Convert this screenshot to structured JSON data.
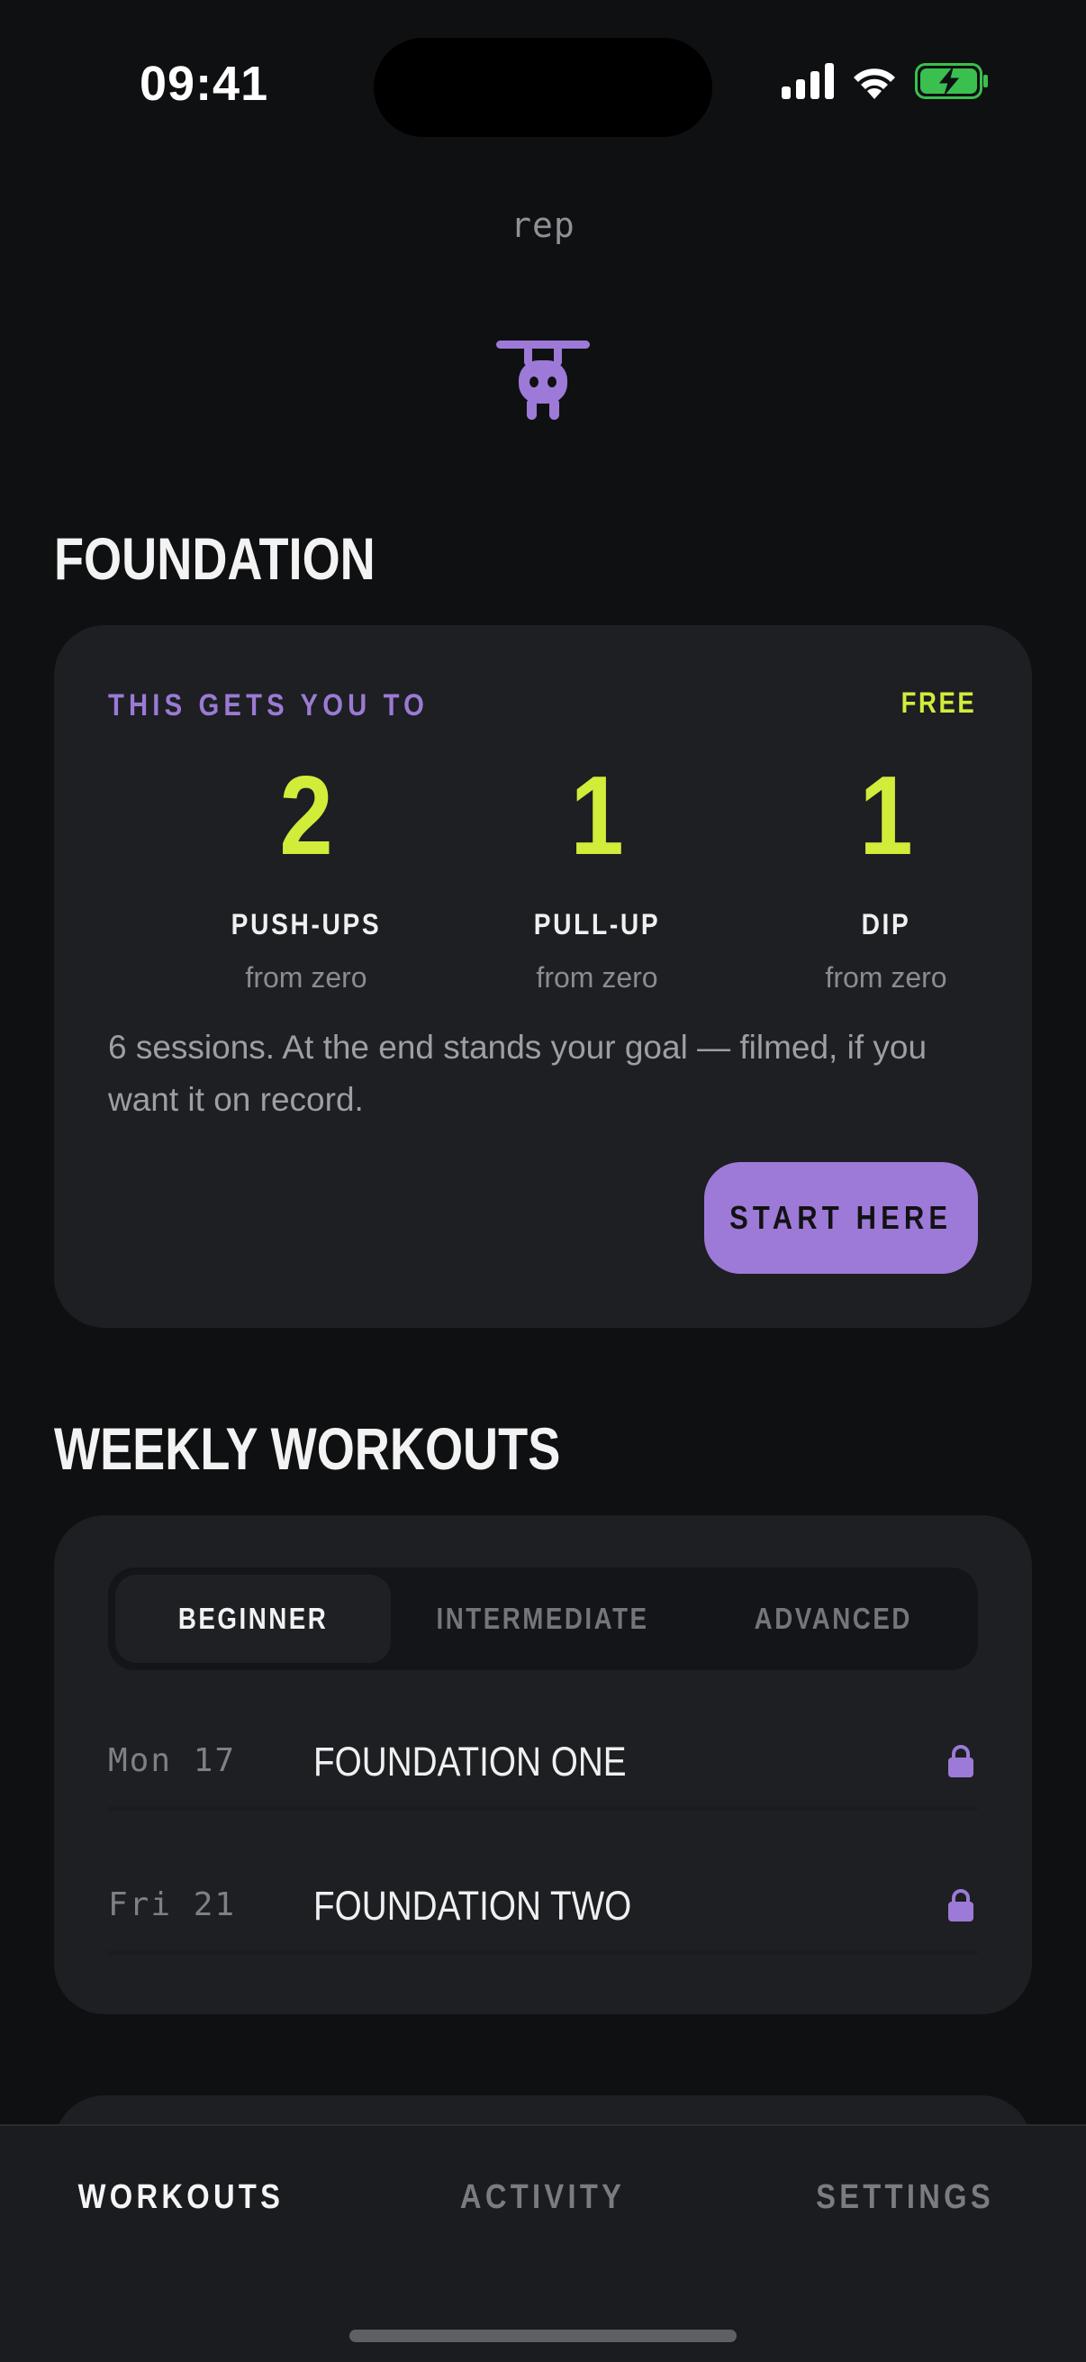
{
  "status_bar": {
    "time": "09:41"
  },
  "brand": {
    "wordmark": "rep"
  },
  "foundation": {
    "title": "FOUNDATION",
    "eyebrow": "THIS GETS YOU TO",
    "badge": "FREE",
    "goals": [
      {
        "count": "2",
        "label": "PUSH-UPS",
        "sub": "from zero"
      },
      {
        "count": "1",
        "label": "PULL-UP",
        "sub": "from zero"
      },
      {
        "count": "1",
        "label": "DIP",
        "sub": "from zero"
      }
    ],
    "description": "6 sessions. At the end stands your goal — filmed, if you want it on record.",
    "cta": "START HERE"
  },
  "weekly": {
    "title": "WEEKLY WORKOUTS",
    "levels": [
      "BEGINNER",
      "INTERMEDIATE",
      "ADVANCED"
    ],
    "selected_level": "BEGINNER",
    "workouts": [
      {
        "date": "Mon 17",
        "title": "FOUNDATION ONE",
        "locked": true
      },
      {
        "date": "Fri 21",
        "title": "FOUNDATION TWO",
        "locked": true
      }
    ]
  },
  "tabs": {
    "items": [
      "WORKOUTS",
      "ACTIVITY",
      "SETTINGS"
    ],
    "active": "WORKOUTS"
  },
  "colors": {
    "background": "#0f1012",
    "card": "#1d1f23",
    "accent_lime": "#d2ec3a",
    "accent_purple": "#9d7ad7"
  }
}
